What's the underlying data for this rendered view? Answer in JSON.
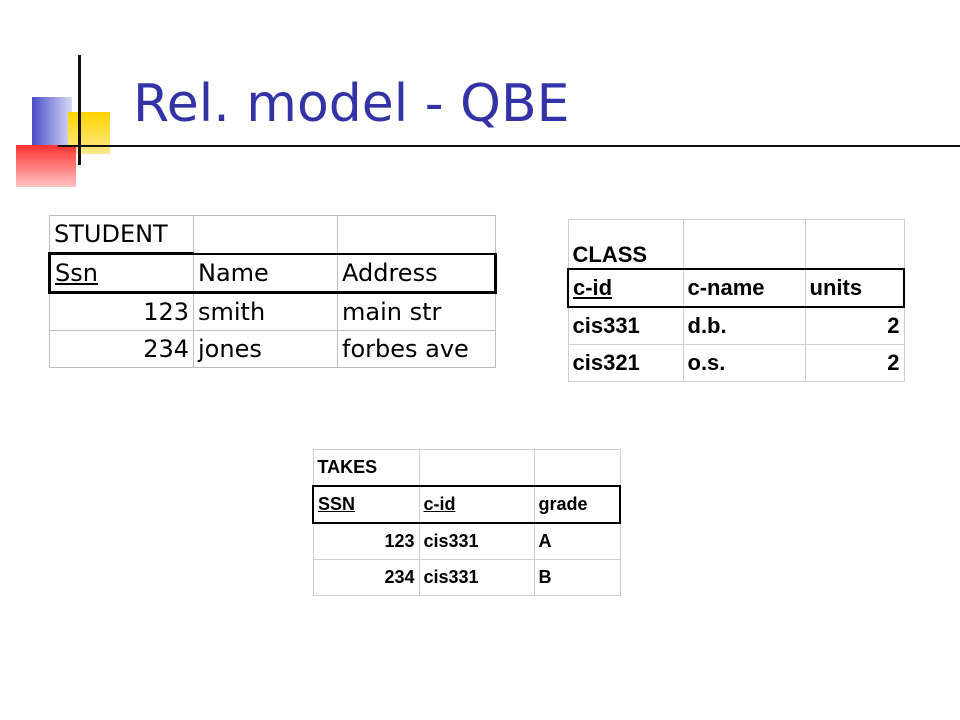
{
  "slide": {
    "title": "Rel. model - QBE"
  },
  "student": {
    "name": "STUDENT",
    "columns": [
      "Ssn",
      "Name",
      "Address"
    ],
    "rows": [
      [
        "123",
        "smith",
        "main str"
      ],
      [
        "234",
        "jones",
        "forbes ave"
      ]
    ]
  },
  "class": {
    "name": "CLASS",
    "columns": [
      "c-id",
      "c-name",
      "units"
    ],
    "rows": [
      [
        "cis331",
        "d.b.",
        "2"
      ],
      [
        "cis321",
        "o.s.",
        "2"
      ]
    ]
  },
  "takes": {
    "name": "TAKES",
    "columns": [
      "SSN",
      "c-id",
      "grade"
    ],
    "rows": [
      [
        "123",
        "cis331",
        "A"
      ],
      [
        "234",
        "cis331",
        "B"
      ]
    ]
  },
  "colors": {
    "title": "#3333a6",
    "logo_blue": "#4a4ec8",
    "logo_yellow": "#ffd400",
    "logo_red": "#ff3030"
  }
}
